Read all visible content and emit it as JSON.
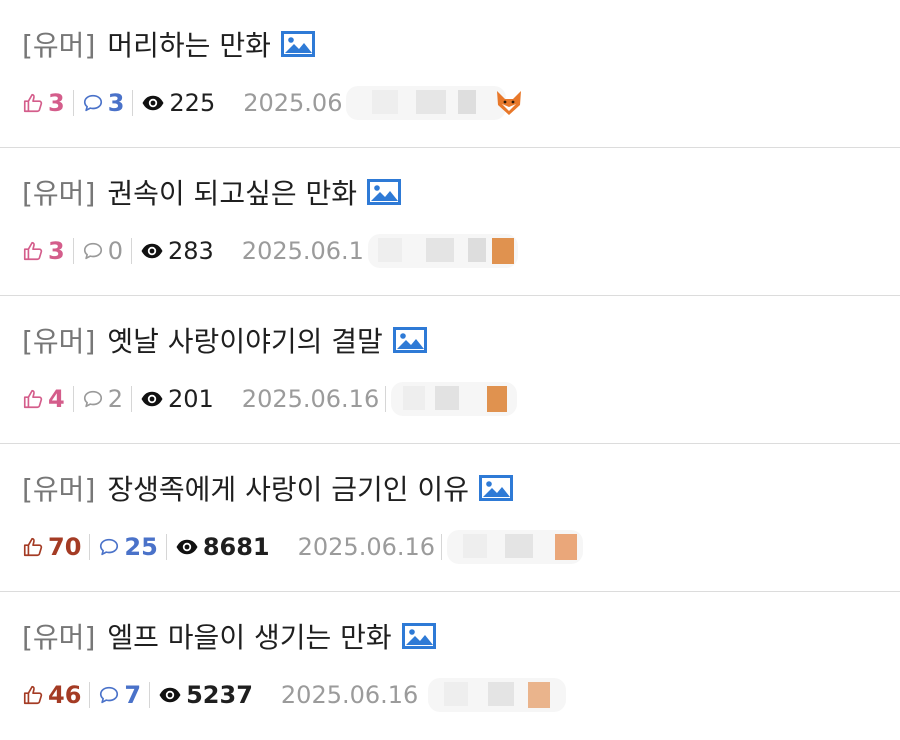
{
  "colors": {
    "like_pink": "#d45d8b",
    "like_red": "#a43b24",
    "comment_active": "#4a72c9",
    "comment_zero": "#9a9a9a",
    "category_gray": "#777777",
    "date_gray": "#9b9b9b",
    "image_icon_blue": "#2e7ad6"
  },
  "icons": {
    "like": "thumbs-up-icon",
    "comment": "speech-bubble-icon",
    "views": "eye-icon",
    "attachment": "image-icon",
    "author_badge": "fox-icon"
  },
  "posts": [
    {
      "category": "[유머]",
      "title": "머리하는 만화",
      "likes": "3",
      "comments": "3",
      "views": "225",
      "date": "2025.06"
    },
    {
      "category": "[유머]",
      "title": "권속이 되고싶은 만화",
      "likes": "3",
      "comments": "0",
      "views": "283",
      "date": "2025.06.1"
    },
    {
      "category": "[유머]",
      "title": "옛날 사랑이야기의 결말",
      "likes": "4",
      "comments": "2",
      "views": "201",
      "date": "2025.06.16"
    },
    {
      "category": "[유머]",
      "title": "장생족에게 사랑이 금기인 이유",
      "likes": "70",
      "comments": "25",
      "views": "8681",
      "date": "2025.06.16"
    },
    {
      "category": "[유머]",
      "title": "엘프 마을이 생기는 만화",
      "likes": "46",
      "comments": "7",
      "views": "5237",
      "date": "2025.06.16"
    }
  ]
}
